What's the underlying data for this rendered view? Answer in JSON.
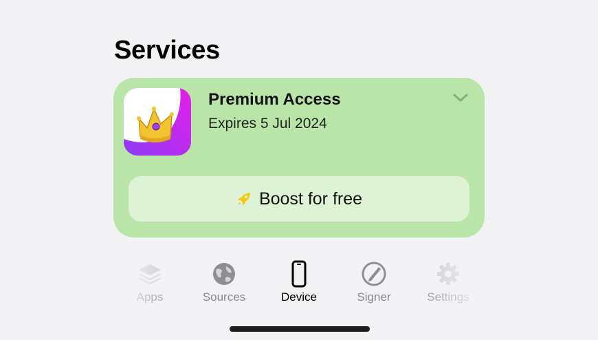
{
  "page": {
    "title": "Services"
  },
  "subscription": {
    "name": "Premium Access",
    "expiry": "Expires 5 Jul 2024",
    "icon": "crown-icon",
    "expand_icon": "chevron-down-icon"
  },
  "boost": {
    "label": "Boost for free",
    "icon": "rocket-icon"
  },
  "tabs": [
    {
      "label": "Apps",
      "icon": "stack-icon",
      "active": false
    },
    {
      "label": "Sources",
      "icon": "globe-icon",
      "active": false
    },
    {
      "label": "Device",
      "icon": "smartphone-icon",
      "active": true
    },
    {
      "label": "Signer",
      "icon": "pen-signature-icon",
      "active": false
    },
    {
      "label": "Settings",
      "icon": "gear-icon",
      "active": false
    }
  ],
  "colors": {
    "card": "#b9e6a8",
    "button": "#def3d6",
    "icon_gradient_start": "#8b3bf5",
    "icon_gradient_end": "#e61ee8",
    "crown": "#f2c230"
  }
}
